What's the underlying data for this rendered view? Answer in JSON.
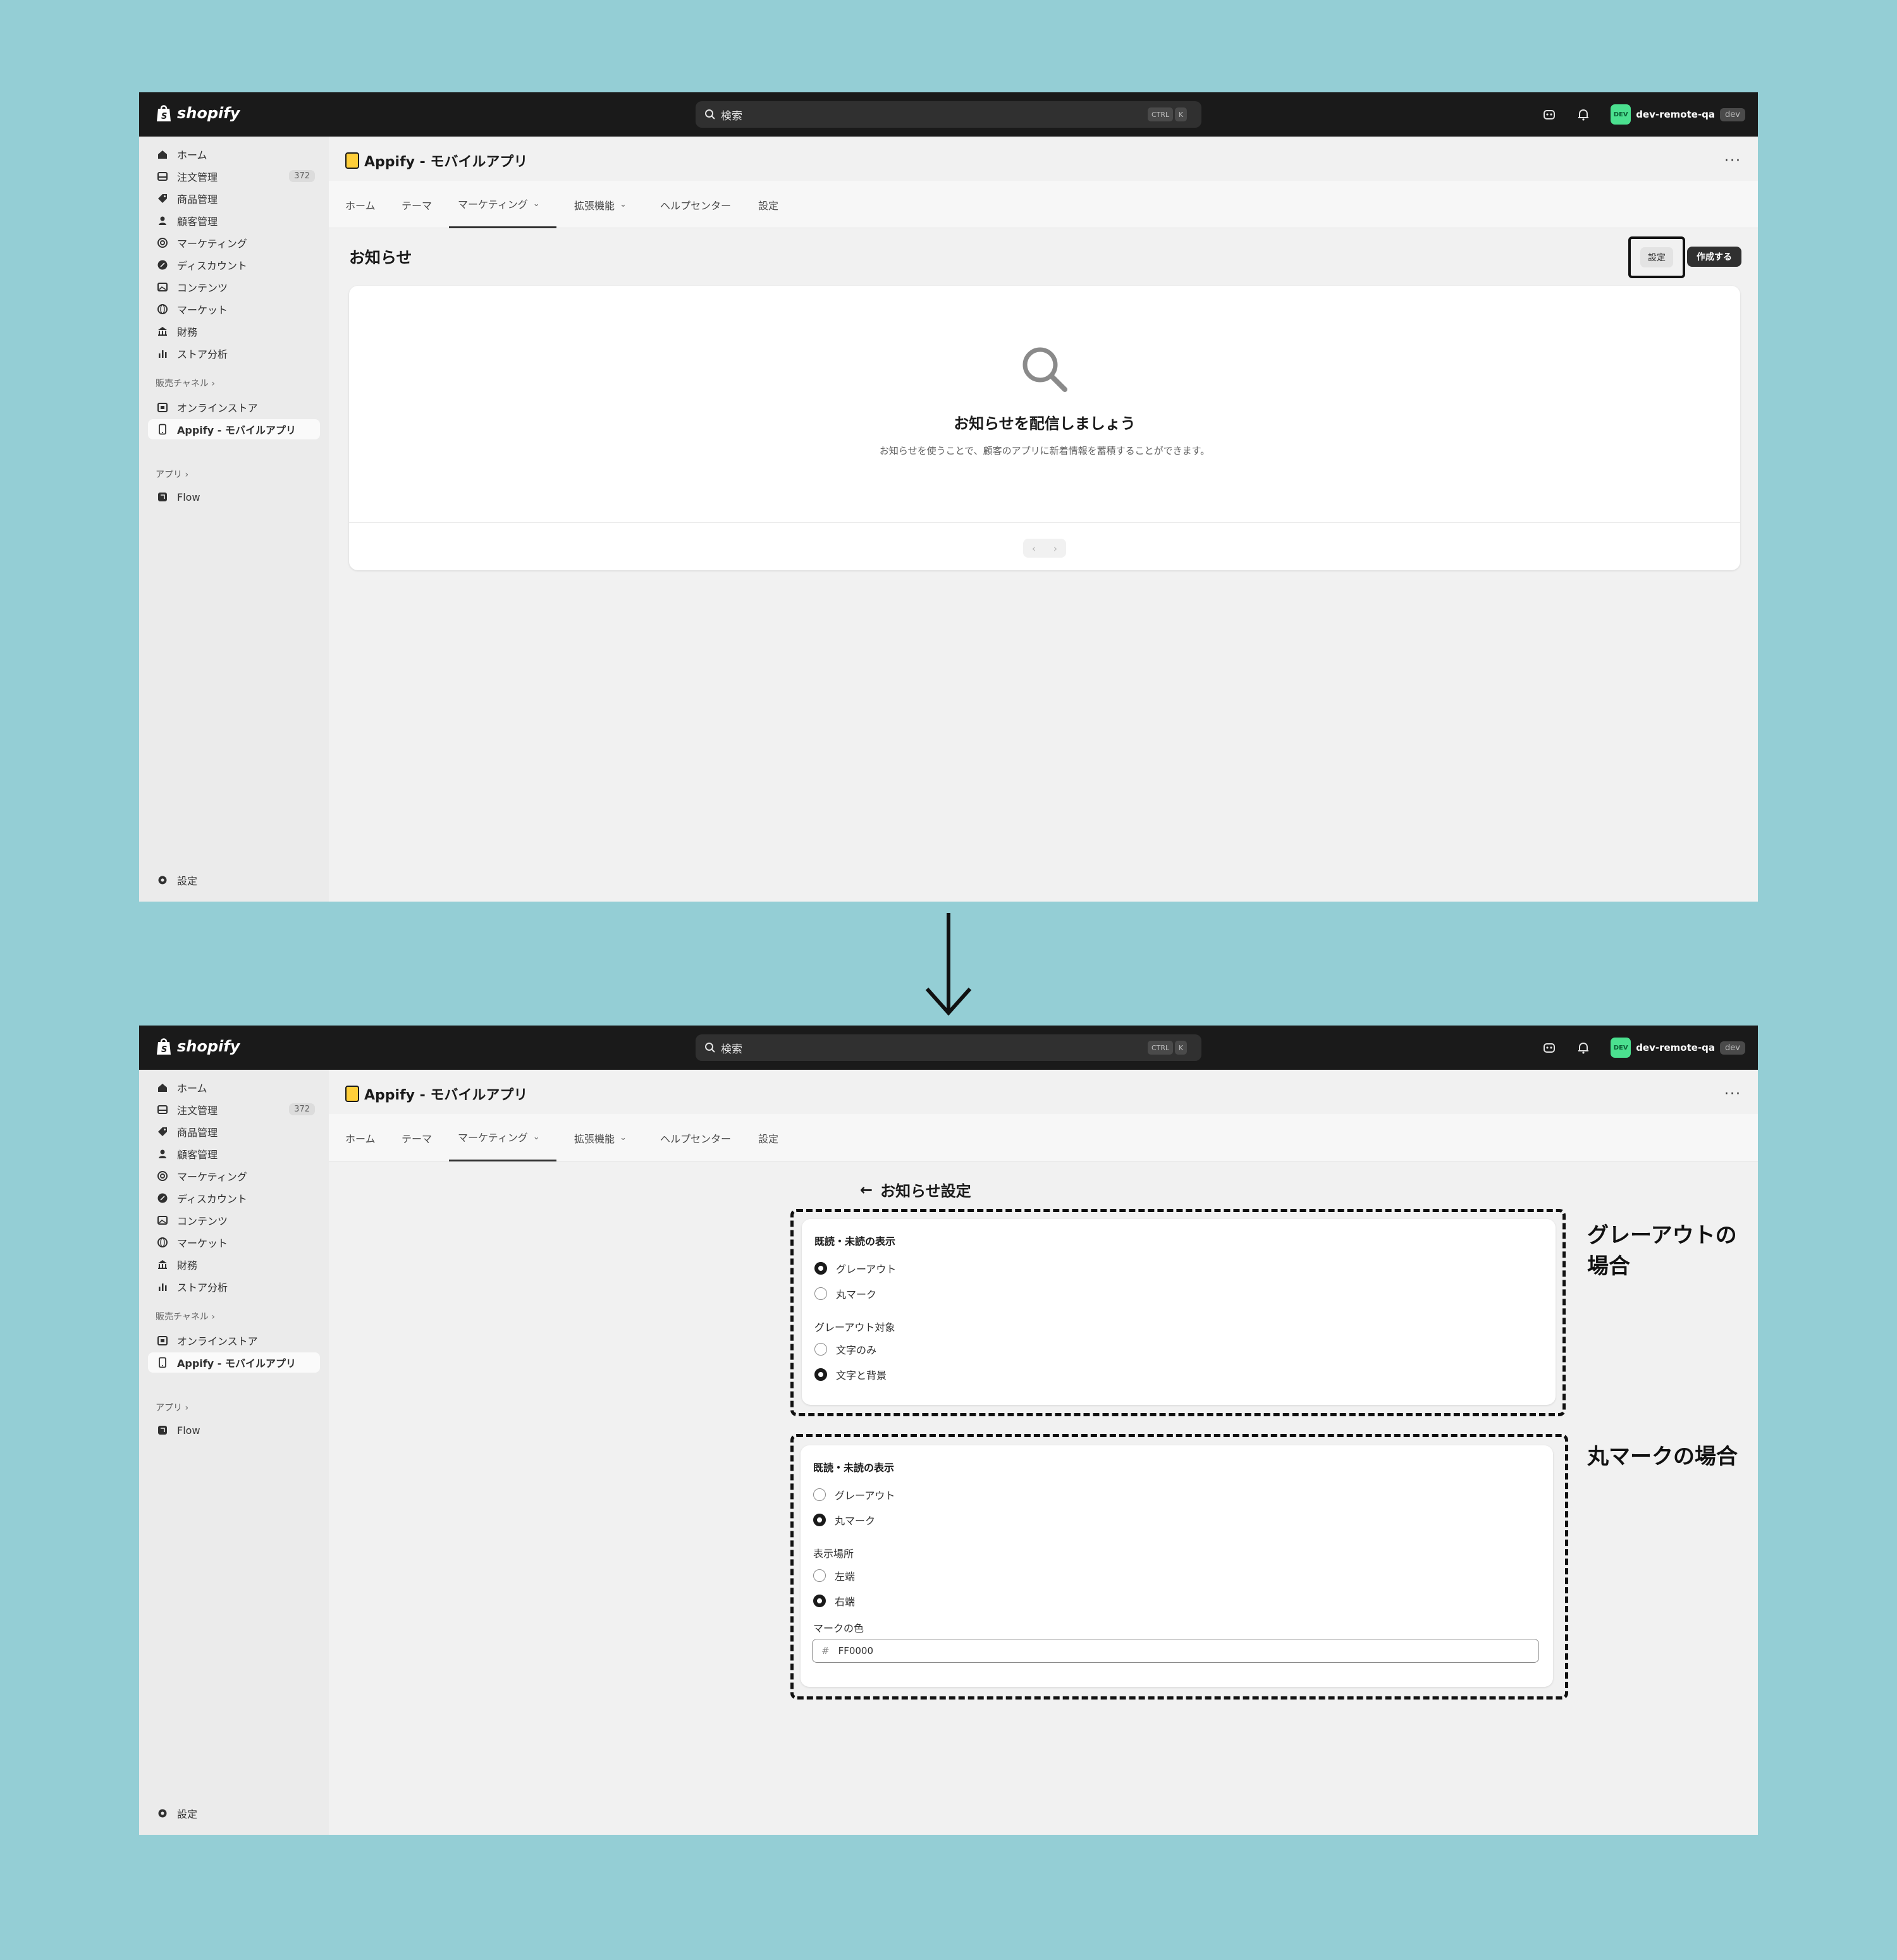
{
  "topbar": {
    "brand": "shopify",
    "search_placeholder": "検索",
    "kbd_ctrl": "CTRL",
    "kbd_k": "K",
    "account_avatar": "DEV",
    "account_name": "dev-remote-qa",
    "account_tag": "dev"
  },
  "sidebar": {
    "items": [
      {
        "label": "ホーム",
        "icon": "home-icon"
      },
      {
        "label": "注文管理",
        "icon": "orders-icon",
        "badge": "372"
      },
      {
        "label": "商品管理",
        "icon": "tag-icon"
      },
      {
        "label": "顧客管理",
        "icon": "person-icon"
      },
      {
        "label": "マーケティング",
        "icon": "target-icon"
      },
      {
        "label": "ディスカウント",
        "icon": "discount-icon"
      },
      {
        "label": "コンテンツ",
        "icon": "image-icon"
      },
      {
        "label": "マーケット",
        "icon": "globe-icon"
      },
      {
        "label": "財務",
        "icon": "bank-icon"
      },
      {
        "label": "ストア分析",
        "icon": "chart-icon"
      }
    ],
    "sales_channels_label": "販売チャネル",
    "channels": [
      {
        "label": "オンラインストア",
        "icon": "store-icon"
      },
      {
        "label": "Appify - モバイルアプリ",
        "icon": "mobile-icon"
      }
    ],
    "apps_label": "アプリ",
    "apps": [
      {
        "label": "Flow",
        "icon": "flow-icon"
      }
    ],
    "settings_label": "設定"
  },
  "app": {
    "title": "Appify - モバイルアプリ",
    "more": "···",
    "tabs": [
      "ホーム",
      "テーマ",
      "マーケティング",
      "拡張機能",
      "ヘルプセンター",
      "設定"
    ]
  },
  "screen1": {
    "page_title": "お知らせ",
    "settings_button": "設定",
    "create_button": "作成する",
    "empty_title": "お知らせを配信しましょう",
    "empty_desc": "お知らせを使うことで、顧客のアプリに新着情報を蓄積することができます。",
    "prev": "‹",
    "next": "›"
  },
  "screen2": {
    "back_title": "お知らせ設定",
    "back_arrow": "←",
    "card1": {
      "display_label": "既読・未読の表示",
      "option_grayout": "グレーアウト",
      "option_circle": "丸マーク",
      "selected_display": "グレーアウト",
      "target_label": "グレーアウト対象",
      "option_text_only": "文字のみ",
      "option_text_bg": "文字と背景",
      "selected_target": "文字と背景"
    },
    "card2": {
      "display_label": "既読・未読の表示",
      "option_grayout": "グレーアウト",
      "option_circle": "丸マーク",
      "selected_display": "丸マーク",
      "position_label": "表示場所",
      "option_left": "左端",
      "option_right": "右端",
      "selected_position": "右端",
      "color_label": "マークの色",
      "color_prefix": "#",
      "color_value": "FF0000"
    },
    "note_grayout": "グレーアウトの場合",
    "note_circle": "丸マークの場合"
  },
  "colors": {
    "background": "#94ced5",
    "topbar": "#1a1a1a",
    "avatar": "#4be08f",
    "app_icon": "#ffcf3a"
  }
}
